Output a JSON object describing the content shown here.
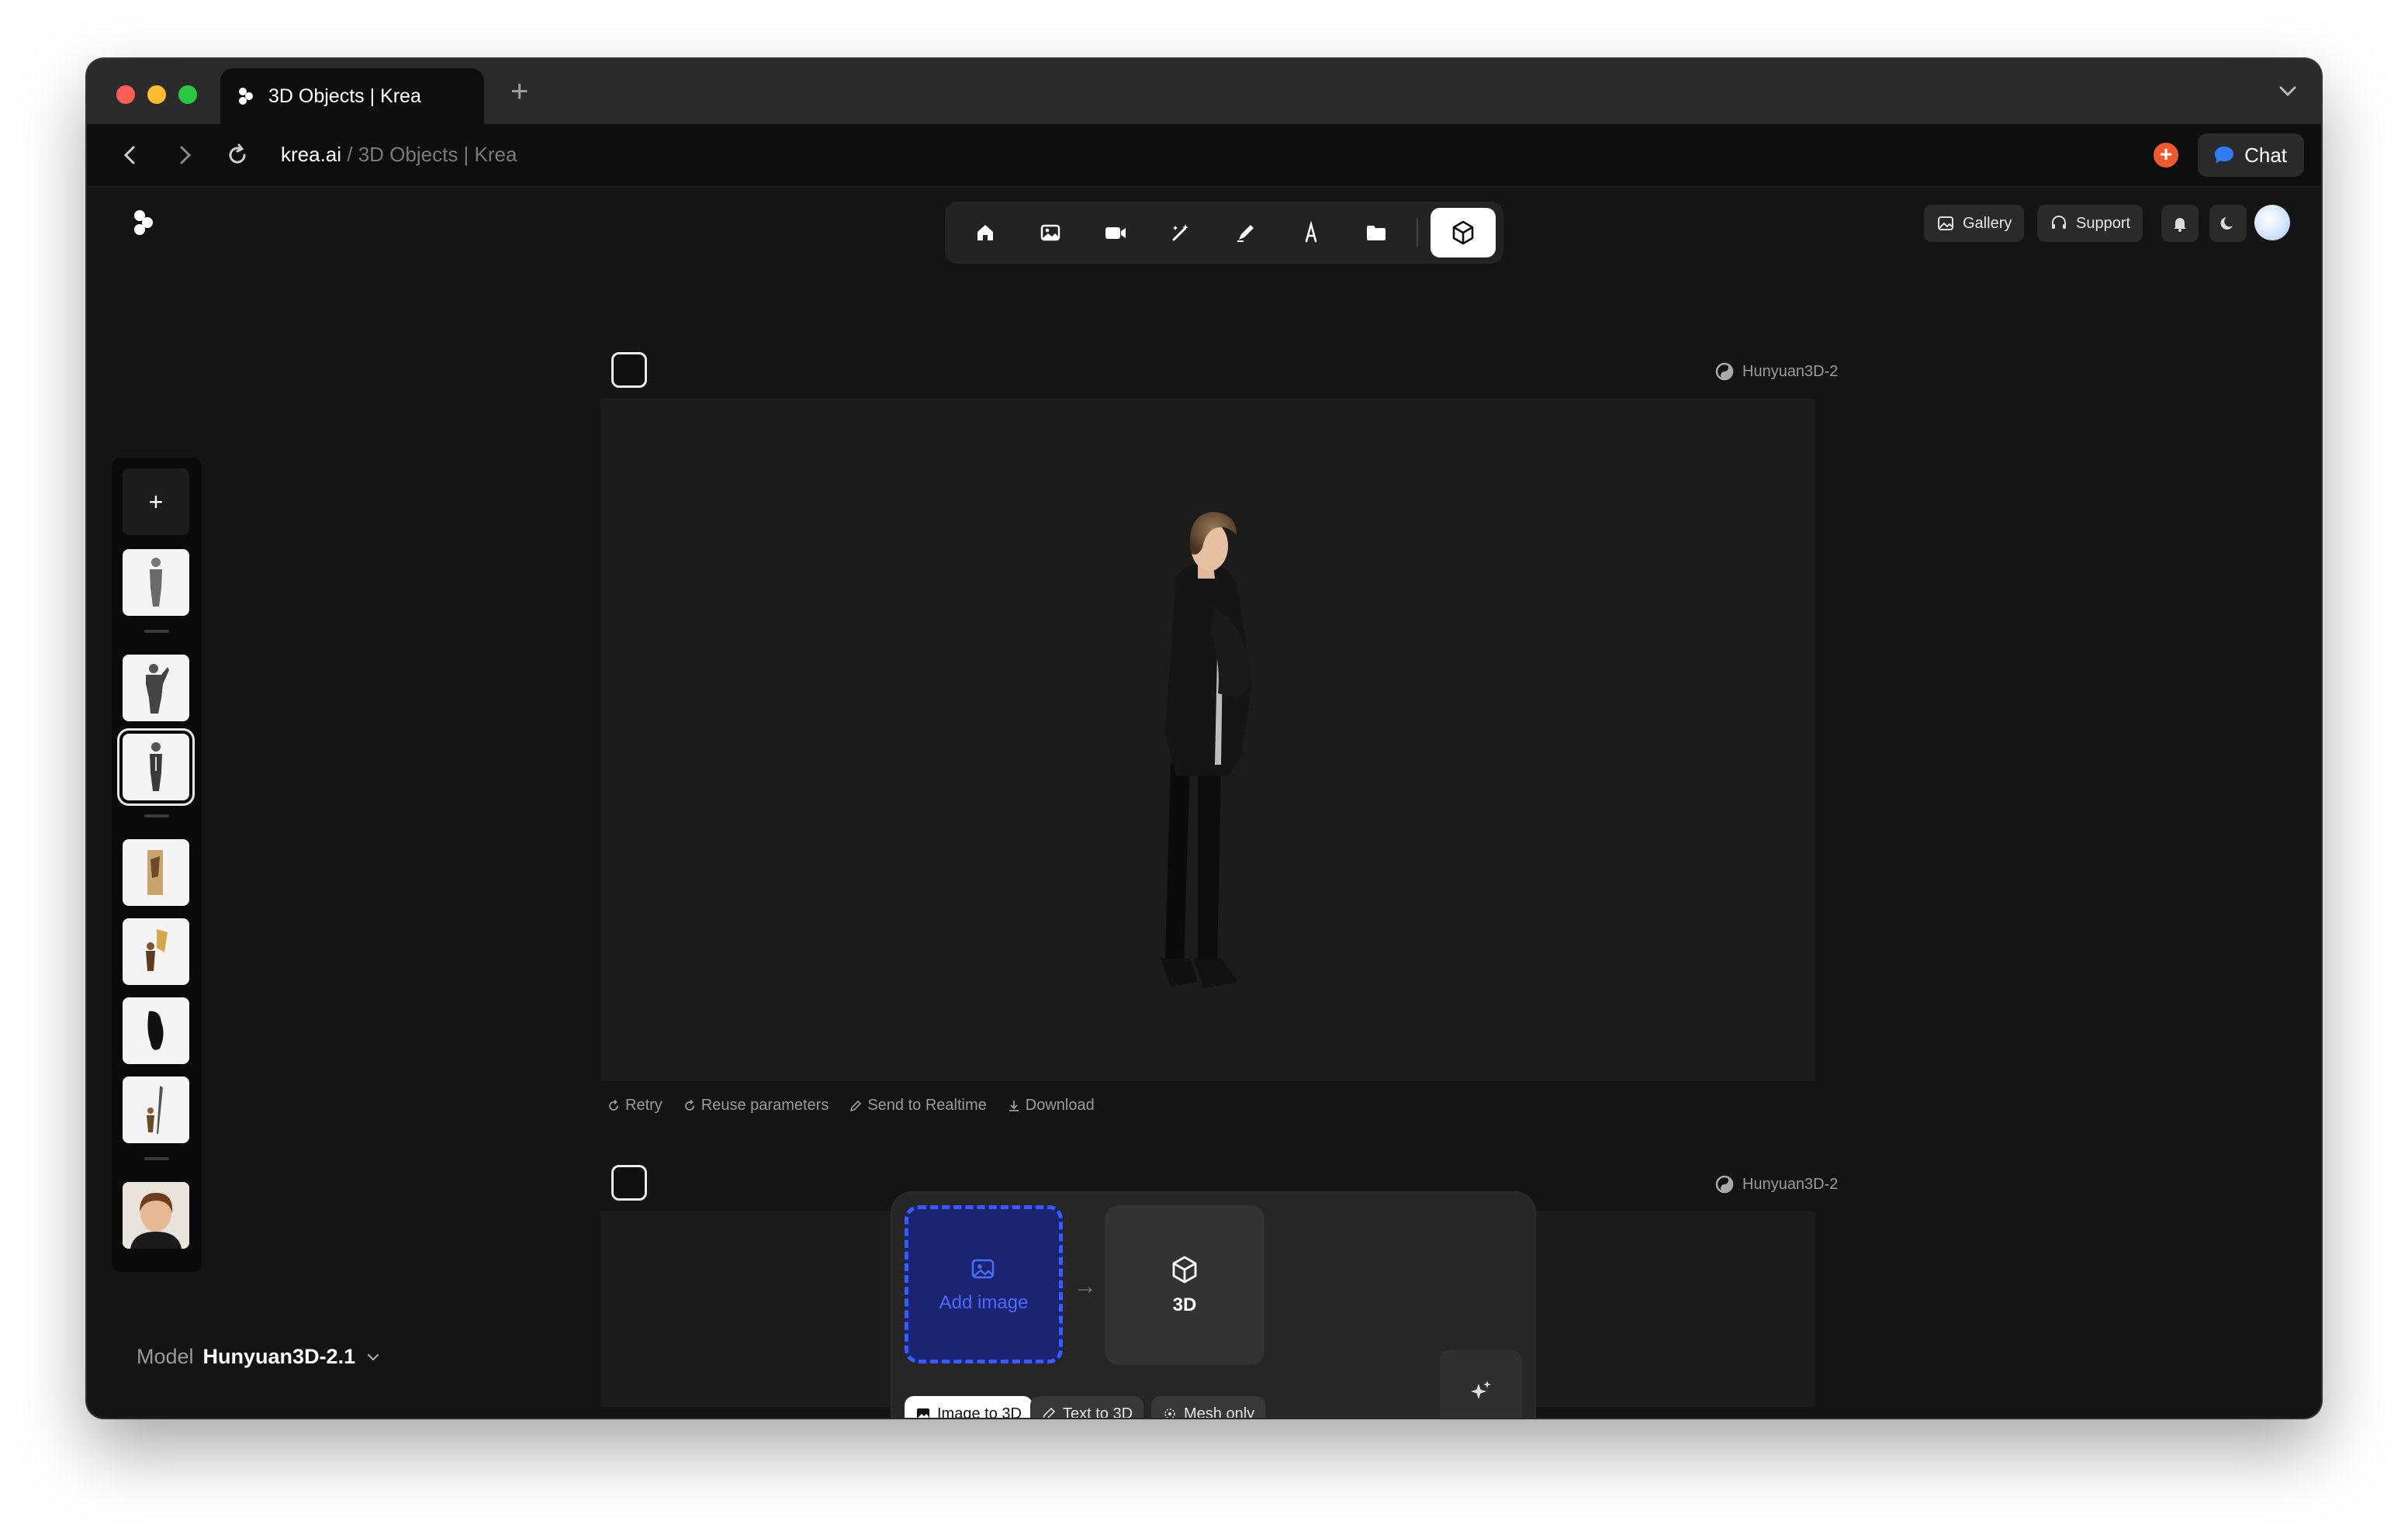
{
  "browser": {
    "tab_title": "3D Objects | Krea",
    "url_domain": "krea.ai",
    "url_path": " / 3D Objects | Krea",
    "chat_label": "Chat"
  },
  "header": {
    "gallery_label": "Gallery",
    "support_label": "Support",
    "nav_items": [
      "home-icon",
      "image-icon",
      "video-icon",
      "enhance-icon",
      "edit-icon",
      "font-icon",
      "folder-icon",
      "cube-icon"
    ],
    "active_nav": "cube-icon"
  },
  "sidebar": {
    "add_label": "+",
    "selected_index": 2
  },
  "model_selector": {
    "label": "Model",
    "value": "Hunyuan3D-2.1"
  },
  "generations": [
    {
      "model": "Hunyuan3D-2",
      "actions": [
        "Retry",
        "Reuse parameters",
        "Send to Realtime",
        "Download"
      ]
    },
    {
      "model": "Hunyuan3D-2"
    }
  ],
  "composer": {
    "add_image_label": "Add image",
    "target_label": "3D",
    "modes": [
      "Image to 3D",
      "Text to 3D",
      "Mesh only"
    ],
    "active_mode": "Image to 3D"
  },
  "colors": {
    "accent_blue": "#3b5bff",
    "background": "#141414",
    "notification_orange": "#ee5a2e"
  }
}
